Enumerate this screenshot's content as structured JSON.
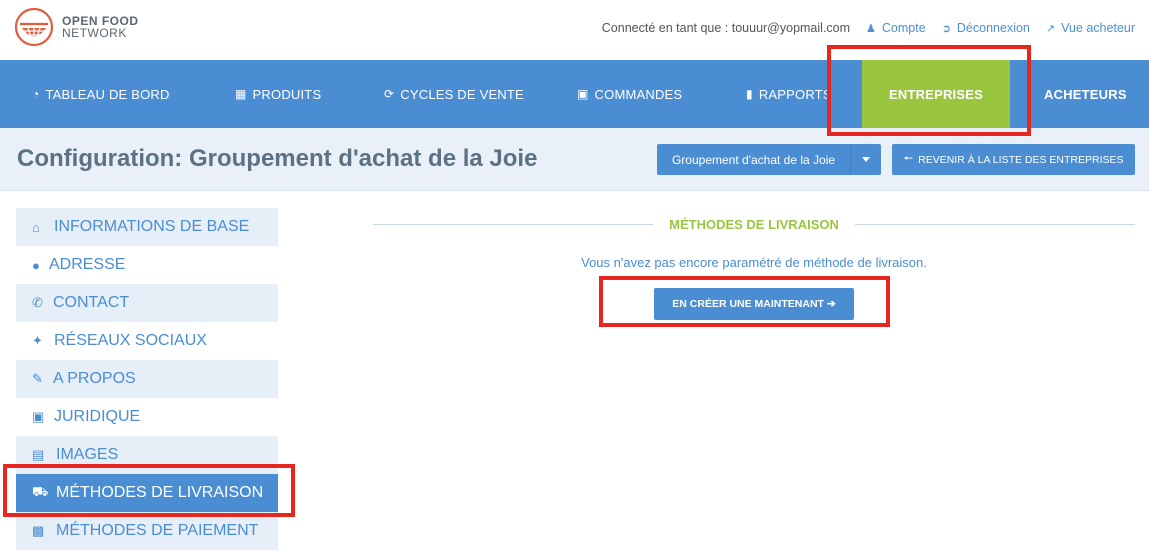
{
  "brand": {
    "line1": "OPEN FOOD",
    "line2": "NETWORK",
    "color": "#e05c3a"
  },
  "user_bar": {
    "logged_in_as": "Connecté en tant que : touuur@yopmail.com",
    "account": "Compte",
    "logout": "Déconnexion",
    "shop_view": "Vue acheteur"
  },
  "nav": {
    "items": [
      {
        "label": "TABLEAU DE BORD",
        "icon": "dashboard-icon"
      },
      {
        "label": "PRODUITS",
        "icon": "grid-icon"
      },
      {
        "label": "CYCLES DE VENTE",
        "icon": "refresh-icon"
      },
      {
        "label": "COMMANDES",
        "icon": "cart-icon"
      },
      {
        "label": "RAPPORTS",
        "icon": "file-icon"
      },
      {
        "label": "ENTREPRISES",
        "icon": ""
      },
      {
        "label": "ACHETEURS",
        "icon": ""
      }
    ],
    "active_index": 5,
    "colors": {
      "bar": "#4a8dd3",
      "active": "#9ac53f"
    }
  },
  "header": {
    "title": "Configuration: Groupement d'achat de la Joie",
    "enterprise_select": "Groupement d'achat de la Joie",
    "back_button": "REVENIR À LA LISTE DES ENTREPRISES"
  },
  "sidebar": {
    "items": [
      {
        "label": "INFORMATIONS DE BASE",
        "icon": "home-icon"
      },
      {
        "label": "ADRESSE",
        "icon": "map-marker-icon"
      },
      {
        "label": "CONTACT",
        "icon": "phone-icon"
      },
      {
        "label": "RÉSEAUX SOCIAUX",
        "icon": "twitter-icon"
      },
      {
        "label": "A PROPOS",
        "icon": "pencil-icon"
      },
      {
        "label": "JURIDIQUE",
        "icon": "briefcase-icon"
      },
      {
        "label": "IMAGES",
        "icon": "image-icon"
      },
      {
        "label": "MÉTHODES DE LIVRAISON",
        "icon": "truck-icon"
      },
      {
        "label": "MÉTHODES DE PAIEMENT",
        "icon": "money-icon"
      }
    ],
    "active_index": 7
  },
  "main": {
    "section_title": "MÉTHODES DE LIVRAISON",
    "empty_message": "Vous n'avez pas encore paramétré de méthode de livraison.",
    "create_button": "EN CRÉER UNE MAINTENANT ➔"
  },
  "highlight_color": "#e6261f"
}
